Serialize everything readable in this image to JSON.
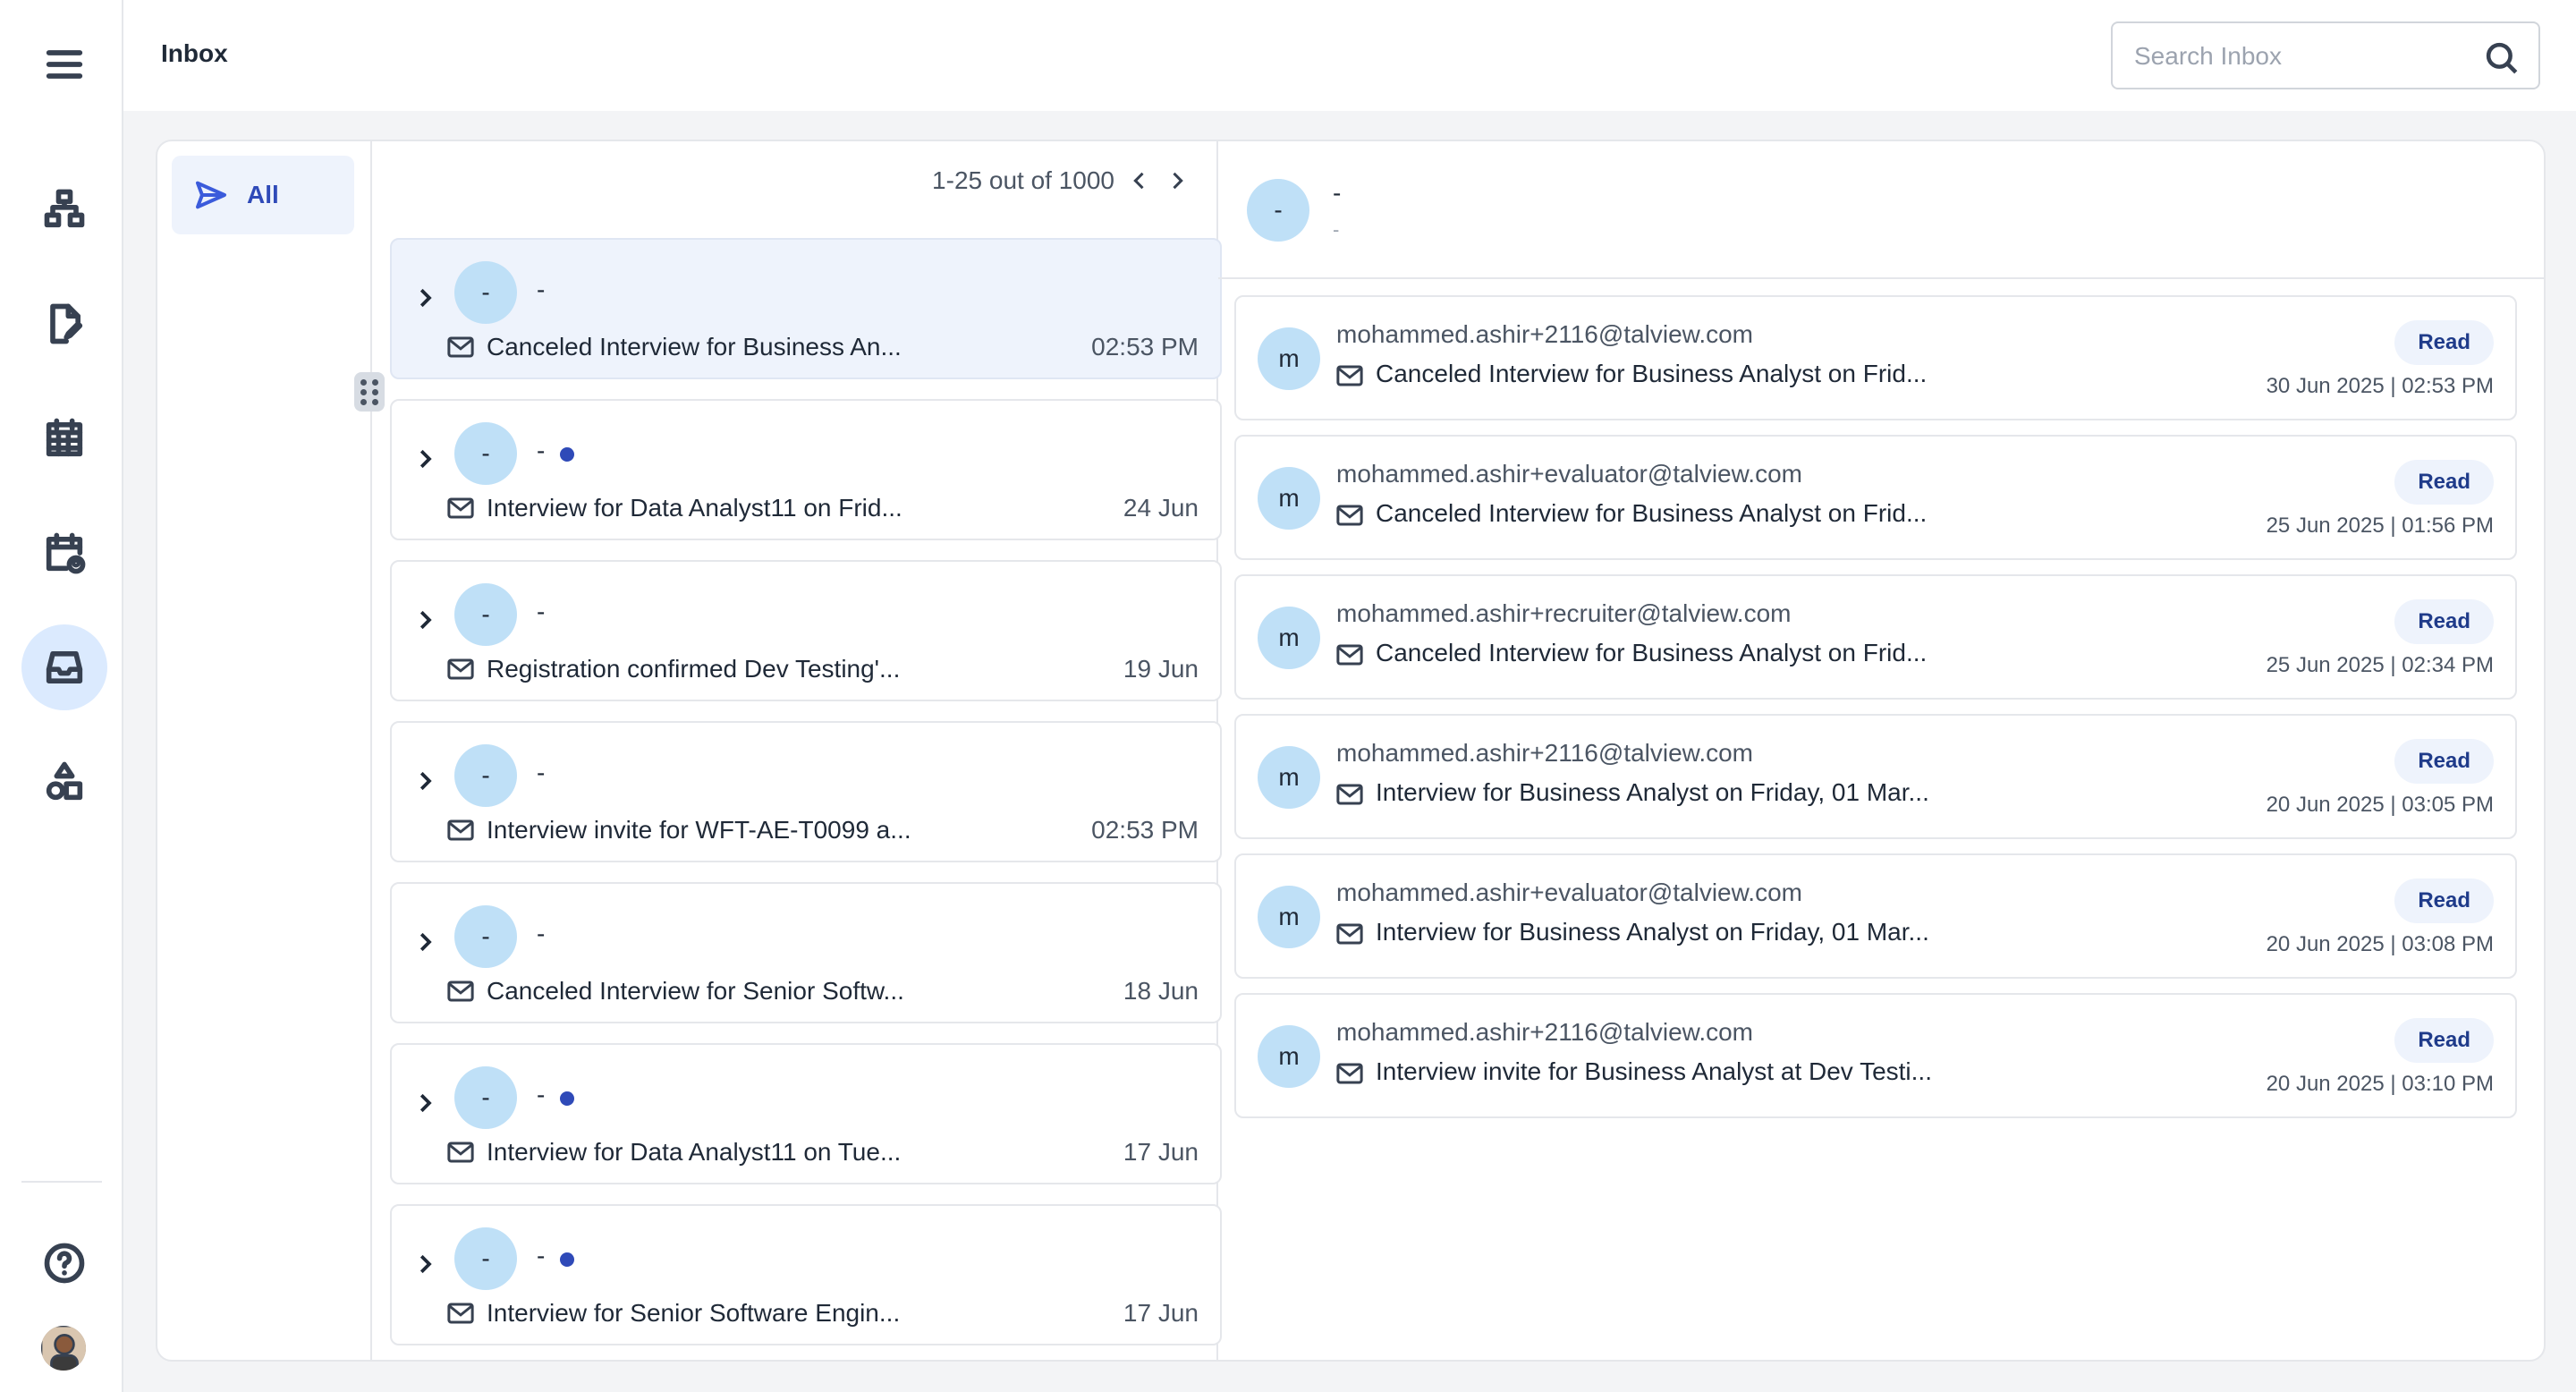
{
  "header": {
    "title": "Inbox"
  },
  "search": {
    "placeholder": "Search Inbox"
  },
  "folders": {
    "all_label": "All"
  },
  "pager": {
    "text": "1-25 out of 1000"
  },
  "threads": [
    {
      "sender": "-",
      "subject": "Canceled Interview for Business An...",
      "time": "02:53 PM",
      "unread": false,
      "selected": true
    },
    {
      "sender": "-",
      "subject": "Interview for Data Analyst11 on Frid...",
      "time": "24 Jun",
      "unread": true,
      "selected": false
    },
    {
      "sender": "-",
      "subject": "Registration confirmed Dev Testing'...",
      "time": "19 Jun",
      "unread": false,
      "selected": false
    },
    {
      "sender": "-",
      "subject": "Interview invite for WFT-AE-T0099 a...",
      "time": "02:53 PM",
      "unread": false,
      "selected": false
    },
    {
      "sender": "-",
      "subject": "Canceled Interview for Senior Softw...",
      "time": "18 Jun",
      "unread": false,
      "selected": false
    },
    {
      "sender": "-",
      "subject": "Interview for Data Analyst11 on Tue...",
      "time": "17 Jun",
      "unread": true,
      "selected": false
    },
    {
      "sender": "-",
      "subject": "Interview for Senior Software Engin...",
      "time": "17 Jun",
      "unread": true,
      "selected": false
    }
  ],
  "detail": {
    "avatar": "-",
    "name": "-",
    "sub": "-",
    "messages": [
      {
        "avatar": "m",
        "from": "mohammed.ashir+2116@talview.com",
        "subject": "Canceled Interview for Business Analyst on Frid...",
        "status": "Read",
        "timestamp": "30 Jun 2025 | 02:53 PM"
      },
      {
        "avatar": "m",
        "from": "mohammed.ashir+evaluator@talview.com",
        "subject": "Canceled Interview for Business Analyst on Frid...",
        "status": "Read",
        "timestamp": "25 Jun 2025 | 01:56 PM"
      },
      {
        "avatar": "m",
        "from": "mohammed.ashir+recruiter@talview.com",
        "subject": "Canceled Interview for Business Analyst on Frid...",
        "status": "Read",
        "timestamp": "25 Jun 2025 | 02:34 PM"
      },
      {
        "avatar": "m",
        "from": "mohammed.ashir+2116@talview.com",
        "subject": "Interview for Business Analyst on Friday, 01 Mar...",
        "status": "Read",
        "timestamp": "20 Jun 2025 | 03:05 PM"
      },
      {
        "avatar": "m",
        "from": "mohammed.ashir+evaluator@talview.com",
        "subject": "Interview for Business Analyst on Friday, 01 Mar...",
        "status": "Read",
        "timestamp": "20 Jun 2025 | 03:08 PM"
      },
      {
        "avatar": "m",
        "from": "mohammed.ashir+2116@talview.com",
        "subject": "Interview invite for Business Analyst at Dev Testi...",
        "status": "Read",
        "timestamp": "20 Jun 2025 | 03:10 PM"
      }
    ]
  },
  "colors": {
    "accent": "#2f4ab8",
    "avatar_bg": "#bfe0f7",
    "selected_bg": "#eef3fc"
  },
  "icons": [
    "menu-icon",
    "workflow-icon",
    "document-edit-icon",
    "calendar-icon",
    "calendar-user-icon",
    "inbox-icon",
    "shapes-icon",
    "help-icon",
    "send-icon",
    "search-icon",
    "mail-icon",
    "chevron-right-icon",
    "chevron-left-icon"
  ]
}
